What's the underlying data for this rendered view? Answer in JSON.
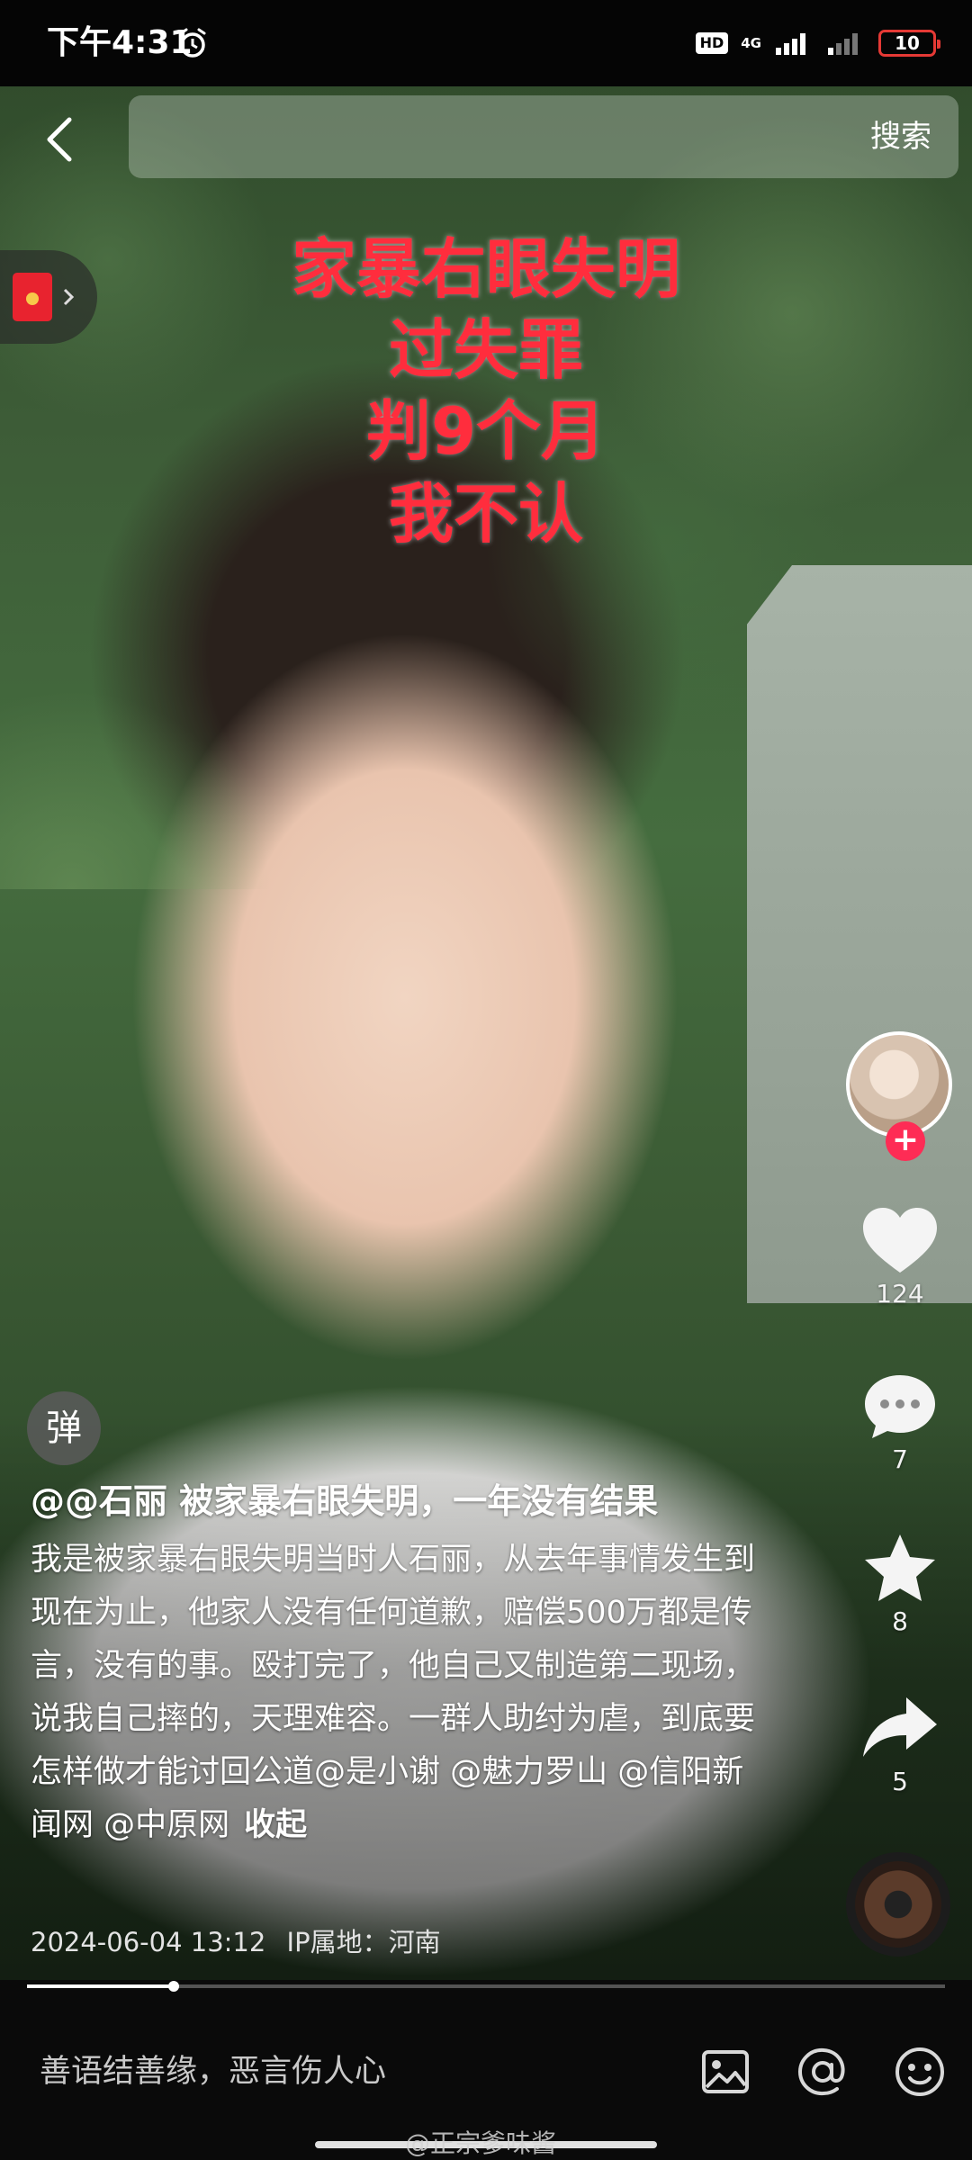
{
  "status_bar": {
    "time": "下午4:31",
    "hd_badge": "HD",
    "network": "4G",
    "battery": "10"
  },
  "header": {
    "search_label": "搜索"
  },
  "video_overlay": {
    "lines": [
      "家暴右眼失明",
      "过失罪",
      "判9个月",
      "我不认"
    ]
  },
  "actions": {
    "likes": "124",
    "comments": "7",
    "favorites": "8",
    "shares": "5"
  },
  "danmu_label": "弹",
  "caption": {
    "title": "@@石丽 被家暴右眼失明，一年没有结果",
    "description": "我是被家暴右眼失明当时人石丽，从去年事情发生到现在为止，他家人没有任何道歉，赔偿500万都是传言，没有的事。殴打完了，他自己又制造第二现场，说我自己摔的，天理难容。一群人助纣为虐，到底要怎样做才能讨回公道@是小谢 @魅力罗山 @信阳新闻网 @中原网",
    "collapse": "收起",
    "timestamp": "2024-06-04 13:12",
    "ip_location": "IP属地：河南"
  },
  "progress": {
    "fraction": 0.16
  },
  "bottom_bar": {
    "comment_placeholder": "善语结善缘，恶言伤人心"
  },
  "watermark": "@正宗爹味酱",
  "colors": {
    "overlay_text": "#ff2d3d",
    "follow_badge": "#fe2c55",
    "battery_low": "#e53935"
  }
}
